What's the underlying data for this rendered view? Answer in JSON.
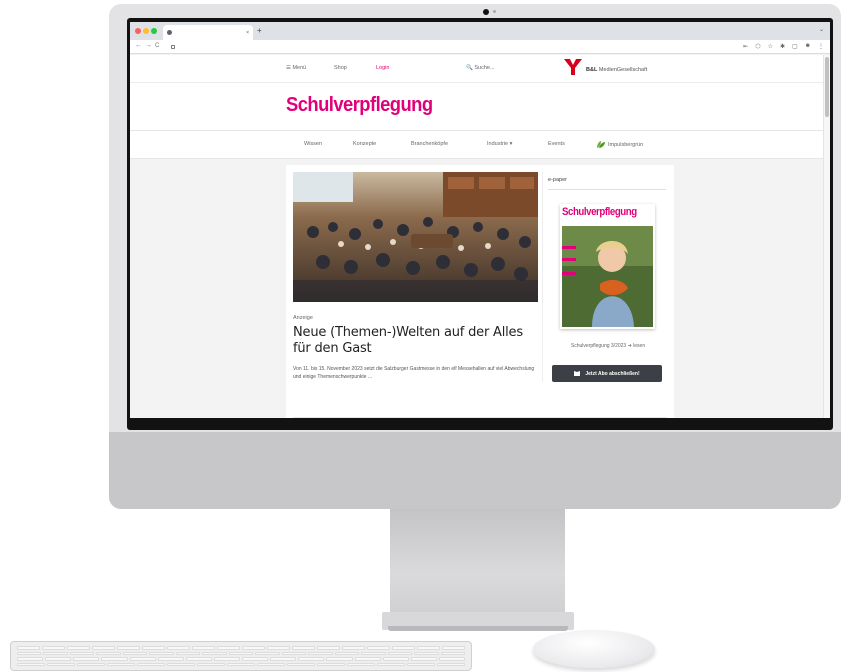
{
  "browser": {
    "tab_title": "",
    "tab_close": "×",
    "new_tab": "+",
    "tab_menu": "⌄",
    "url": "",
    "nav_back": "←",
    "nav_forward": "→",
    "nav_reload": "C",
    "toolbar_icons": [
      "⇤",
      "⬡",
      "☆",
      "✱",
      "▢",
      "☻",
      "⋮"
    ]
  },
  "header": {
    "menu_label": "☰ Menü",
    "shop_label": "Shop",
    "login_label": "Login",
    "search_label": "🔍 Suche...",
    "publisher_name_bold": "B&L",
    "publisher_name_rest": " MedienGesellschaft",
    "site_logo": "Schulverpflegung"
  },
  "nav": {
    "items": [
      "Wissen",
      "Konzepte",
      "Branchenköpfe",
      "Industrie ▾",
      "Events",
      "Impulsbergrün"
    ]
  },
  "article": {
    "kicker": "Anzeige",
    "title": "Neue (Themen-)Welten auf der Alles für den Gast",
    "teaser": "Von 11. bis 15. November 2023 setzt die Salzburger Gastmesse in den elf Messehallen auf viel Abwechslung und einige Themenschwerpunkte ..."
  },
  "sidebar": {
    "heading": "e-paper",
    "cover_masthead": "Schulverpflegung",
    "caption": "Schulverpflegung 3/2023 ➜ lesen",
    "abo_button": "Jetzt Abo abschließen!"
  },
  "footer_peek": [
    "",
    "",
    ""
  ],
  "colors": {
    "brand_pink": "#e2007a",
    "button_dark": "#3c3f45",
    "leaf_green": "#6fb33b",
    "publisher_red": "#d6001c"
  }
}
